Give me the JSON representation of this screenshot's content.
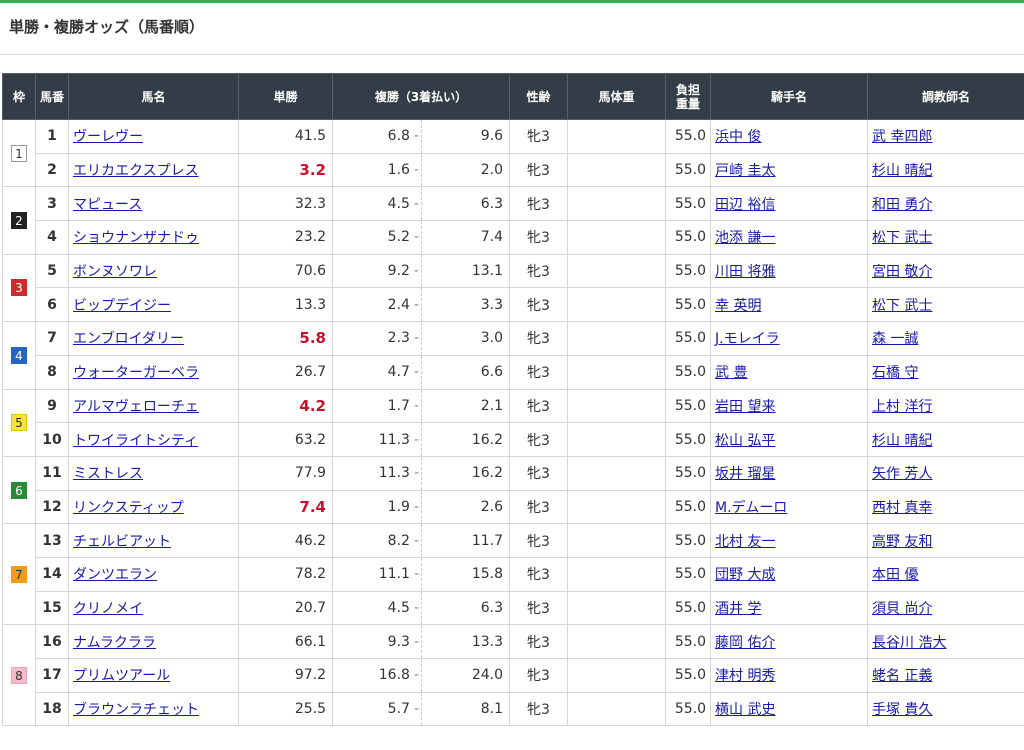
{
  "title": "単勝・複勝オッズ（馬番順）",
  "headers": {
    "waku": "枠",
    "umaban": "馬番",
    "horse": "馬名",
    "win": "単勝",
    "place": "複勝（3着払い）",
    "sex_age": "性齢",
    "body_weight": "馬体重",
    "burden_1": "負担",
    "burden_2": "重量",
    "jockey": "騎手名",
    "trainer": "調教師名"
  },
  "colors": {
    "accent": "#2fb14b",
    "header_bg": "#333d47",
    "favorite_odds": "#c8102e",
    "link": "#1a1aa6"
  },
  "waku_colors": {
    "1": {
      "bg": "#ffffff",
      "fg": "#333333",
      "border": "#999999"
    },
    "2": {
      "bg": "#222222",
      "fg": "#ffffff",
      "border": "#222222"
    },
    "3": {
      "bg": "#d12a2a",
      "fg": "#ffffff",
      "border": "#d12a2a"
    },
    "4": {
      "bg": "#2566c4",
      "fg": "#ffffff",
      "border": "#2566c4"
    },
    "5": {
      "bg": "#f7e13a",
      "fg": "#333333",
      "border": "#e0c800"
    },
    "6": {
      "bg": "#2a8a3a",
      "fg": "#ffffff",
      "border": "#2a8a3a"
    },
    "7": {
      "bg": "#f59a1b",
      "fg": "#333333",
      "border": "#f59a1b"
    },
    "8": {
      "bg": "#f6b9c9",
      "fg": "#333333",
      "border": "#eea0b4"
    }
  },
  "dash_char": "-",
  "rows": [
    {
      "waku": "1",
      "waku_span": 2,
      "num": "1",
      "name": "ヴーレヴー",
      "win": "41.5",
      "fav": false,
      "pmin": "6.8",
      "pmax": "9.6",
      "sex": "牝3",
      "bw": "",
      "wt": "55.0",
      "jockey": "浜中 俊",
      "trainer": "武 幸四郎"
    },
    {
      "waku": "1",
      "waku_span": 0,
      "num": "2",
      "name": "エリカエクスプレス",
      "win": "3.2",
      "fav": true,
      "pmin": "1.6",
      "pmax": "2.0",
      "sex": "牝3",
      "bw": "",
      "wt": "55.0",
      "jockey": "戸崎 圭太",
      "trainer": "杉山 晴紀"
    },
    {
      "waku": "2",
      "waku_span": 2,
      "num": "3",
      "name": "マピュース",
      "win": "32.3",
      "fav": false,
      "pmin": "4.5",
      "pmax": "6.3",
      "sex": "牝3",
      "bw": "",
      "wt": "55.0",
      "jockey": "田辺 裕信",
      "trainer": "和田 勇介"
    },
    {
      "waku": "2",
      "waku_span": 0,
      "num": "4",
      "name": "ショウナンザナドゥ",
      "win": "23.2",
      "fav": false,
      "pmin": "5.2",
      "pmax": "7.4",
      "sex": "牝3",
      "bw": "",
      "wt": "55.0",
      "jockey": "池添 謙一",
      "trainer": "松下 武士"
    },
    {
      "waku": "3",
      "waku_span": 2,
      "num": "5",
      "name": "ボンヌソワレ",
      "win": "70.6",
      "fav": false,
      "pmin": "9.2",
      "pmax": "13.1",
      "sex": "牝3",
      "bw": "",
      "wt": "55.0",
      "jockey": "川田 将雅",
      "trainer": "宮田 敬介"
    },
    {
      "waku": "3",
      "waku_span": 0,
      "num": "6",
      "name": "ビップデイジー",
      "win": "13.3",
      "fav": false,
      "pmin": "2.4",
      "pmax": "3.3",
      "sex": "牝3",
      "bw": "",
      "wt": "55.0",
      "jockey": "幸 英明",
      "trainer": "松下 武士"
    },
    {
      "waku": "4",
      "waku_span": 2,
      "num": "7",
      "name": "エンブロイダリー",
      "win": "5.8",
      "fav": true,
      "pmin": "2.3",
      "pmax": "3.0",
      "sex": "牝3",
      "bw": "",
      "wt": "55.0",
      "jockey": "J.モレイラ",
      "trainer": "森 一誠"
    },
    {
      "waku": "4",
      "waku_span": 0,
      "num": "8",
      "name": "ウォーターガーベラ",
      "win": "26.7",
      "fav": false,
      "pmin": "4.7",
      "pmax": "6.6",
      "sex": "牝3",
      "bw": "",
      "wt": "55.0",
      "jockey": "武 豊",
      "trainer": "石橋 守"
    },
    {
      "waku": "5",
      "waku_span": 2,
      "num": "9",
      "name": "アルマヴェローチェ",
      "win": "4.2",
      "fav": true,
      "pmin": "1.7",
      "pmax": "2.1",
      "sex": "牝3",
      "bw": "",
      "wt": "55.0",
      "jockey": "岩田 望来",
      "trainer": "上村 洋行"
    },
    {
      "waku": "5",
      "waku_span": 0,
      "num": "10",
      "name": "トワイライトシティ",
      "win": "63.2",
      "fav": false,
      "pmin": "11.3",
      "pmax": "16.2",
      "sex": "牝3",
      "bw": "",
      "wt": "55.0",
      "jockey": "松山 弘平",
      "trainer": "杉山 晴紀"
    },
    {
      "waku": "6",
      "waku_span": 2,
      "num": "11",
      "name": "ミストレス",
      "win": "77.9",
      "fav": false,
      "pmin": "11.3",
      "pmax": "16.2",
      "sex": "牝3",
      "bw": "",
      "wt": "55.0",
      "jockey": "坂井 瑠星",
      "trainer": "矢作 芳人"
    },
    {
      "waku": "6",
      "waku_span": 0,
      "num": "12",
      "name": "リンクスティップ",
      "win": "7.4",
      "fav": true,
      "pmin": "1.9",
      "pmax": "2.6",
      "sex": "牝3",
      "bw": "",
      "wt": "55.0",
      "jockey": "M.デムーロ",
      "trainer": "西村 真幸"
    },
    {
      "waku": "7",
      "waku_span": 3,
      "num": "13",
      "name": "チェルビアット",
      "win": "46.2",
      "fav": false,
      "pmin": "8.2",
      "pmax": "11.7",
      "sex": "牝3",
      "bw": "",
      "wt": "55.0",
      "jockey": "北村 友一",
      "trainer": "高野 友和"
    },
    {
      "waku": "7",
      "waku_span": 0,
      "num": "14",
      "name": "ダンツエラン",
      "win": "78.2",
      "fav": false,
      "pmin": "11.1",
      "pmax": "15.8",
      "sex": "牝3",
      "bw": "",
      "wt": "55.0",
      "jockey": "団野 大成",
      "trainer": "本田 優"
    },
    {
      "waku": "7",
      "waku_span": 0,
      "num": "15",
      "name": "クリノメイ",
      "win": "20.7",
      "fav": false,
      "pmin": "4.5",
      "pmax": "6.3",
      "sex": "牝3",
      "bw": "",
      "wt": "55.0",
      "jockey": "酒井 学",
      "trainer": "須貝 尚介"
    },
    {
      "waku": "8",
      "waku_span": 3,
      "num": "16",
      "name": "ナムラクララ",
      "win": "66.1",
      "fav": false,
      "pmin": "9.3",
      "pmax": "13.3",
      "sex": "牝3",
      "bw": "",
      "wt": "55.0",
      "jockey": "藤岡 佑介",
      "trainer": "長谷川 浩大"
    },
    {
      "waku": "8",
      "waku_span": 0,
      "num": "17",
      "name": "プリムツアール",
      "win": "97.2",
      "fav": false,
      "pmin": "16.8",
      "pmax": "24.0",
      "sex": "牝3",
      "bw": "",
      "wt": "55.0",
      "jockey": "津村 明秀",
      "trainer": "蛯名 正義"
    },
    {
      "waku": "8",
      "waku_span": 0,
      "num": "18",
      "name": "ブラウンラチェット",
      "win": "25.5",
      "fav": false,
      "pmin": "5.7",
      "pmax": "8.1",
      "sex": "牝3",
      "bw": "",
      "wt": "55.0",
      "jockey": "横山 武史",
      "trainer": "手塚 貴久"
    }
  ]
}
